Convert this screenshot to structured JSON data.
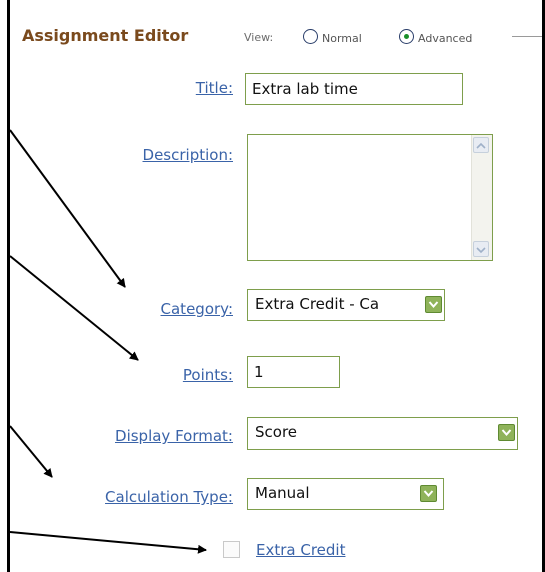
{
  "header": {
    "title": "Assignment Editor",
    "view_label": "View:",
    "view_options": [
      {
        "label": "Normal",
        "selected": false
      },
      {
        "label": "Advanced",
        "selected": true
      }
    ]
  },
  "form": {
    "title": {
      "label": "Title:",
      "value": "Extra lab time"
    },
    "description": {
      "label": "Description:",
      "value": ""
    },
    "category": {
      "label": "Category:",
      "selected": "Extra Credit - Ca"
    },
    "points": {
      "label": "Points:",
      "value": "1"
    },
    "display_format": {
      "label": "Display Format:",
      "selected": "Score"
    },
    "calculation_type": {
      "label": "Calculation Type:",
      "selected": "Manual"
    },
    "extra_credit": {
      "label": "Extra Credit",
      "checked": false
    }
  },
  "colors": {
    "title": "#7a4a1d",
    "link": "#3a63a8",
    "field_border": "#7e9e4c",
    "dropdown_button": "#8fb35a"
  }
}
